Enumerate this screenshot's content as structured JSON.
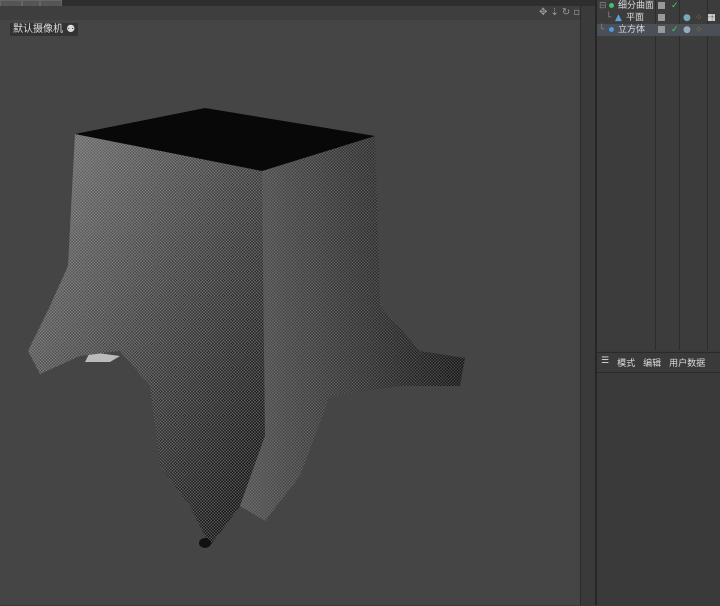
{
  "viewport": {
    "camera_label": "默认摄像机",
    "nav_icons": [
      "move-icon",
      "zoom-icon",
      "rotate-icon",
      "maximize-icon"
    ]
  },
  "objects": [
    {
      "name": "细分曲面",
      "icon": "subdivision-icon",
      "color": "#3ec26b"
    },
    {
      "name": "平面",
      "icon": "plane-icon",
      "color": "#5aa0e0"
    },
    {
      "name": "立方体",
      "icon": "cube-icon",
      "color": "#4a9ae0"
    }
  ],
  "attributes": {
    "menu": [
      "模式",
      "编辑",
      "用户数据"
    ]
  }
}
